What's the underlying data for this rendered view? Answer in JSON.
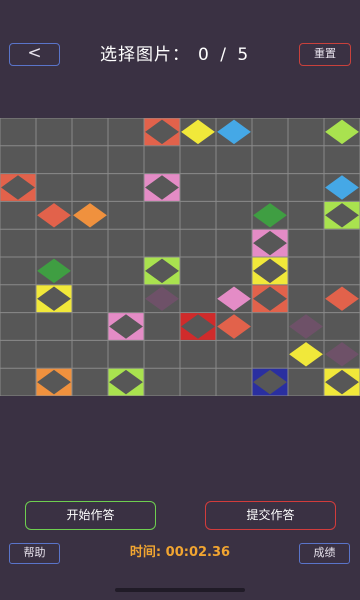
{
  "header": {
    "back_label": "<",
    "title": "选择图片：",
    "progress": "0 / 5",
    "reset_label": "重置"
  },
  "board": {
    "rows": 10,
    "cols": 10,
    "background": "#575757",
    "grid_line_color": "#8a8a8a",
    "tiles": [
      {
        "row": 0,
        "col": 4,
        "color": "#e2624b",
        "fill": "frame"
      },
      {
        "row": 0,
        "col": 5,
        "color": "#f1e83a",
        "fill": "solid"
      },
      {
        "row": 0,
        "col": 6,
        "color": "#45a8e6",
        "fill": "solid"
      },
      {
        "row": 0,
        "col": 9,
        "color": "#a9e24f",
        "fill": "solid"
      },
      {
        "row": 2,
        "col": 0,
        "color": "#e2624b",
        "fill": "frame"
      },
      {
        "row": 2,
        "col": 4,
        "color": "#e48cc6",
        "fill": "frame"
      },
      {
        "row": 2,
        "col": 9,
        "color": "#45a8e6",
        "fill": "solid"
      },
      {
        "row": 3,
        "col": 1,
        "color": "#e2624b",
        "fill": "solid"
      },
      {
        "row": 3,
        "col": 2,
        "color": "#f0913e",
        "fill": "solid"
      },
      {
        "row": 3,
        "col": 7,
        "color": "#3f9e42",
        "fill": "solid"
      },
      {
        "row": 3,
        "col": 9,
        "color": "#a9e24f",
        "fill": "frame"
      },
      {
        "row": 4,
        "col": 7,
        "color": "#e48cc6",
        "fill": "frame"
      },
      {
        "row": 5,
        "col": 1,
        "color": "#3f9e42",
        "fill": "solid"
      },
      {
        "row": 5,
        "col": 4,
        "color": "#a9e24f",
        "fill": "frame"
      },
      {
        "row": 5,
        "col": 7,
        "color": "#f1e83a",
        "fill": "frame"
      },
      {
        "row": 6,
        "col": 1,
        "color": "#f1e83a",
        "fill": "frame"
      },
      {
        "row": 6,
        "col": 4,
        "color": "#6e5168",
        "fill": "solid"
      },
      {
        "row": 6,
        "col": 6,
        "color": "#e48cc6",
        "fill": "solid"
      },
      {
        "row": 6,
        "col": 7,
        "color": "#e2624b",
        "fill": "frame"
      },
      {
        "row": 6,
        "col": 9,
        "color": "#e2624b",
        "fill": "solid"
      },
      {
        "row": 7,
        "col": 3,
        "color": "#e48cc6",
        "fill": "frame"
      },
      {
        "row": 7,
        "col": 5,
        "color": "#d02b2b",
        "fill": "frame"
      },
      {
        "row": 7,
        "col": 6,
        "color": "#e2624b",
        "fill": "solid"
      },
      {
        "row": 7,
        "col": 8,
        "color": "#6e5168",
        "fill": "solid"
      },
      {
        "row": 8,
        "col": 8,
        "color": "#f1e83a",
        "fill": "solid"
      },
      {
        "row": 8,
        "col": 9,
        "color": "#6e5168",
        "fill": "solid"
      },
      {
        "row": 9,
        "col": 1,
        "color": "#f0913e",
        "fill": "frame"
      },
      {
        "row": 9,
        "col": 3,
        "color": "#a9e24f",
        "fill": "frame"
      },
      {
        "row": 9,
        "col": 7,
        "color": "#2a2fa0",
        "fill": "frame"
      },
      {
        "row": 9,
        "col": 9,
        "color": "#f1e83a",
        "fill": "frame"
      }
    ]
  },
  "footer": {
    "start_label": "开始作答",
    "submit_label": "提交作答",
    "help_label": "帮助",
    "timer_label": "时间: ",
    "timer_value": "00:02.36",
    "results_label": "成绩"
  },
  "colors": {
    "background": "#3a3143",
    "nav_border": "#5a74c9",
    "danger_border": "#c9413c",
    "start_border": "#6ecf50",
    "timer_color": "#f1a531"
  }
}
